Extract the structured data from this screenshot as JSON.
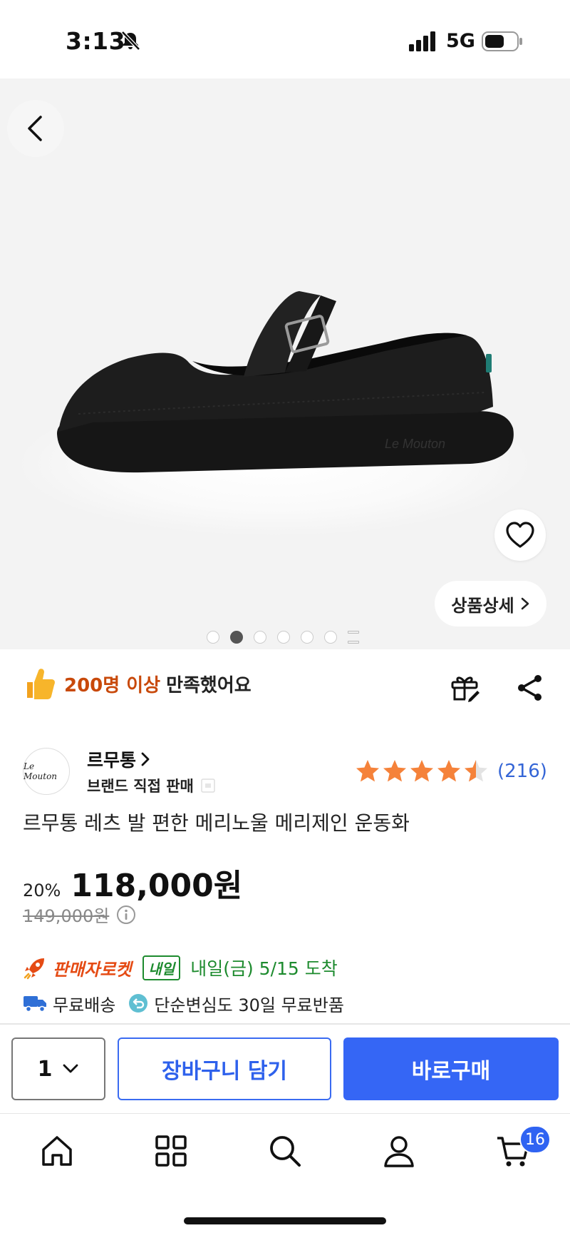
{
  "status_bar": {
    "time": "3:13",
    "network": "5G"
  },
  "gallery": {
    "detail_button": "상품상세",
    "total_slides": 6,
    "active_slide": 2
  },
  "satisfaction": {
    "count_text": "200명 이상",
    "text": "만족했어요"
  },
  "brand": {
    "logo_text": "Le Mouton",
    "name": "르무통",
    "sub": "브랜드 직접 판매"
  },
  "rating": {
    "stars": 4.5,
    "count": "(216)"
  },
  "product": {
    "title": "르무통 레츠 발 편한 메리노울 메리제인 운동화",
    "discount": "20%",
    "price": "118,000원",
    "original_price": "149,000원"
  },
  "delivery": {
    "rocket_label": "판매자로켓",
    "badge": "내일",
    "arrival": "내일(금) 5/15 도착",
    "free_shipping": "무료배송",
    "free_return": "단순변심도 30일 무료반품"
  },
  "purchase_bar": {
    "quantity": "1",
    "cart_button": "장바구니 담기",
    "buy_button": "바로구매"
  },
  "tabbar": {
    "items": [
      "home-icon",
      "category-icon",
      "search-icon",
      "profile-icon",
      "cart-icon"
    ],
    "cart_badge": "16"
  },
  "colors": {
    "accent_blue": "#3566f5",
    "satisfy_orange": "#c8490a",
    "rocket_red": "#e54b14",
    "delivery_green": "#1d8b2e",
    "star_orange": "#f5823a",
    "rating_blue": "#3465d6"
  }
}
